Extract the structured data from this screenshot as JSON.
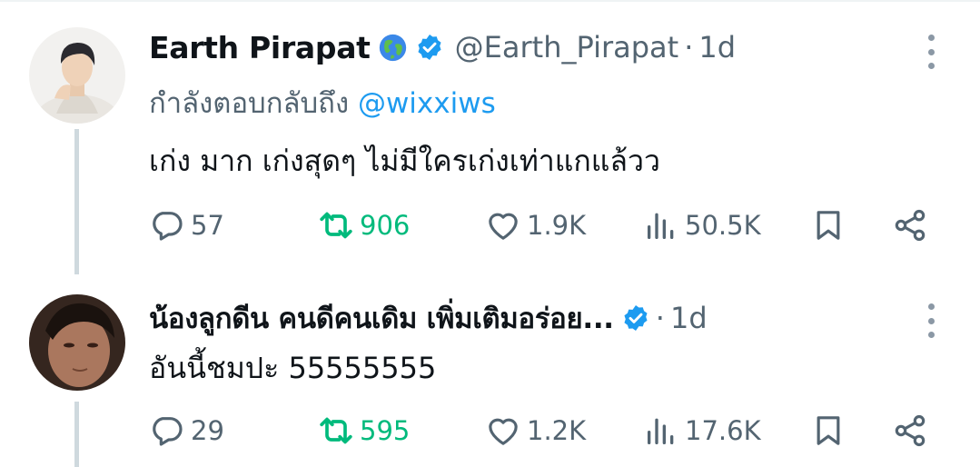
{
  "tweets": [
    {
      "display_name": "Earth Pirapat",
      "handle": "@Earth_Pirapat",
      "separator": "·",
      "time": "1d",
      "reply_prefix": "กำลังตอบกลับถึง",
      "reply_to": "@wixxiws",
      "text": "เก่ง มาก เก่งสุดๆ ไม่มีใครเก่งเท่าแกแล้วว",
      "replies": "57",
      "retweets": "906",
      "likes": "1.9K",
      "views": "50.5K"
    },
    {
      "display_name": "น้องลูกดีน คนดีคนเดิม เพิ่มเติมอร่อย...",
      "separator": "·",
      "time": "1d",
      "text": "อันนี้ชมปะ 55555555",
      "replies": "29",
      "retweets": "595",
      "likes": "1.2K",
      "views": "17.6K"
    }
  ],
  "icons": {
    "reply": "reply-icon",
    "retweet": "retweet-icon",
    "like": "heart-icon",
    "views": "views-icon",
    "bookmark": "bookmark-icon",
    "share": "share-icon",
    "verified": "verified-badge-icon",
    "globe": "globe-emoji-icon",
    "more": "more-icon"
  },
  "colors": {
    "text": "#0f1419",
    "secondary": "#536471",
    "link": "#1d9bf0",
    "retweet_active": "#00ba7c",
    "verified": "#1d9bf0",
    "thread_line": "#cfd9de"
  }
}
